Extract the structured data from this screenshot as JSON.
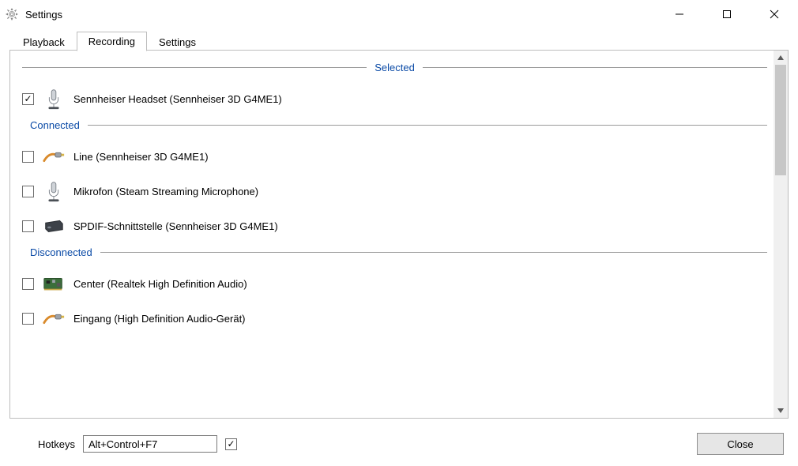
{
  "window": {
    "title": "Settings"
  },
  "tabs": [
    {
      "label": "Playback",
      "active": false
    },
    {
      "label": "Recording",
      "active": true
    },
    {
      "label": "Settings",
      "active": false
    }
  ],
  "groups": {
    "selected": {
      "label": "Selected",
      "items": [
        {
          "checked": true,
          "icon": "mic",
          "label": "Sennheiser Headset (Sennheiser 3D G4ME1)"
        }
      ]
    },
    "connected": {
      "label": "Connected",
      "items": [
        {
          "checked": false,
          "icon": "cable",
          "label": "Line (Sennheiser 3D G4ME1)"
        },
        {
          "checked": false,
          "icon": "mic",
          "label": "Mikrofon (Steam Streaming Microphone)"
        },
        {
          "checked": false,
          "icon": "box",
          "label": "SPDIF-Schnittstelle (Sennheiser 3D G4ME1)"
        }
      ]
    },
    "disconnected": {
      "label": "Disconnected",
      "items": [
        {
          "checked": false,
          "icon": "card",
          "label": "Center (Realtek High Definition Audio)"
        },
        {
          "checked": false,
          "icon": "cable",
          "label": "Eingang (High Definition Audio-Gerät)"
        }
      ]
    }
  },
  "footer": {
    "hotkeys_label": "Hotkeys",
    "hotkeys_value": "Alt+Control+F7",
    "hotkeys_checked": true,
    "close_label": "Close"
  }
}
